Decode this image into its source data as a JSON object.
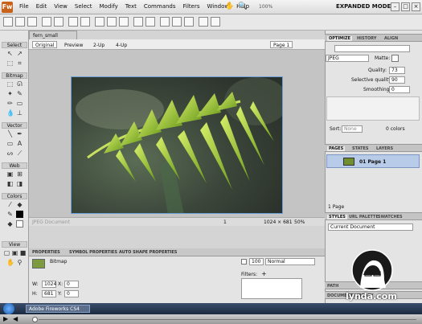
{
  "menu": {
    "items": [
      "File",
      "Edit",
      "View",
      "Select",
      "Modify",
      "Text",
      "Commands",
      "Filters",
      "Window",
      "Help"
    ],
    "zoom": "100%",
    "workspace": "EXPANDED MODE"
  },
  "tools": {
    "sections": [
      "Select",
      "Bitmap",
      "Vector",
      "Web",
      "Colors",
      "View"
    ]
  },
  "document": {
    "tab": "fern_small",
    "views": [
      "Original",
      "Preview",
      "2-Up",
      "4-Up"
    ],
    "page_select": "Page 1",
    "status_page": "1",
    "dimensions": "1024 × 681",
    "zoom": "50%",
    "ghost_label": "JPEG Document"
  },
  "properties": {
    "tabs": [
      "PROPERTIES",
      "SYMBOL PROPERTIES",
      "AUTO SHAPE PROPERTIES"
    ],
    "object_type": "Bitmap",
    "w_label": "W:",
    "w": "1024",
    "h_label": "H:",
    "h": "681",
    "x_label": "X:",
    "x": "0",
    "y_label": "Y:",
    "y": "0",
    "opacity": "100",
    "blend": "Normal",
    "filters_label": "Filters:"
  },
  "optimize": {
    "tabs": [
      "OPTIMIZE",
      "HISTORY",
      "ALIGN"
    ],
    "format": "JPEG",
    "matte_label": "Matte:",
    "quality_label": "Quality:",
    "quality": "73",
    "selective_label": "Selective quality:",
    "selective": "90",
    "smoothing_label": "Smoothing:",
    "smoothing": "0",
    "sort_label": "Sort:",
    "sort": "None",
    "colors": "0 colors"
  },
  "pages": {
    "tabs": [
      "PAGES",
      "STATES",
      "LAYERS"
    ],
    "item": "01  Page 1",
    "count": "1 Page"
  },
  "styles": {
    "tabs": [
      "STYLES",
      "URL PALETTE",
      "SWATCHES"
    ],
    "select": "Current Document"
  },
  "bottom_tabs": [
    "PATH",
    "DOCUMENT LIBRARY"
  ],
  "taskbar": {
    "item": "Adobe Fireworks CS4"
  },
  "watermark": "lynda.com"
}
